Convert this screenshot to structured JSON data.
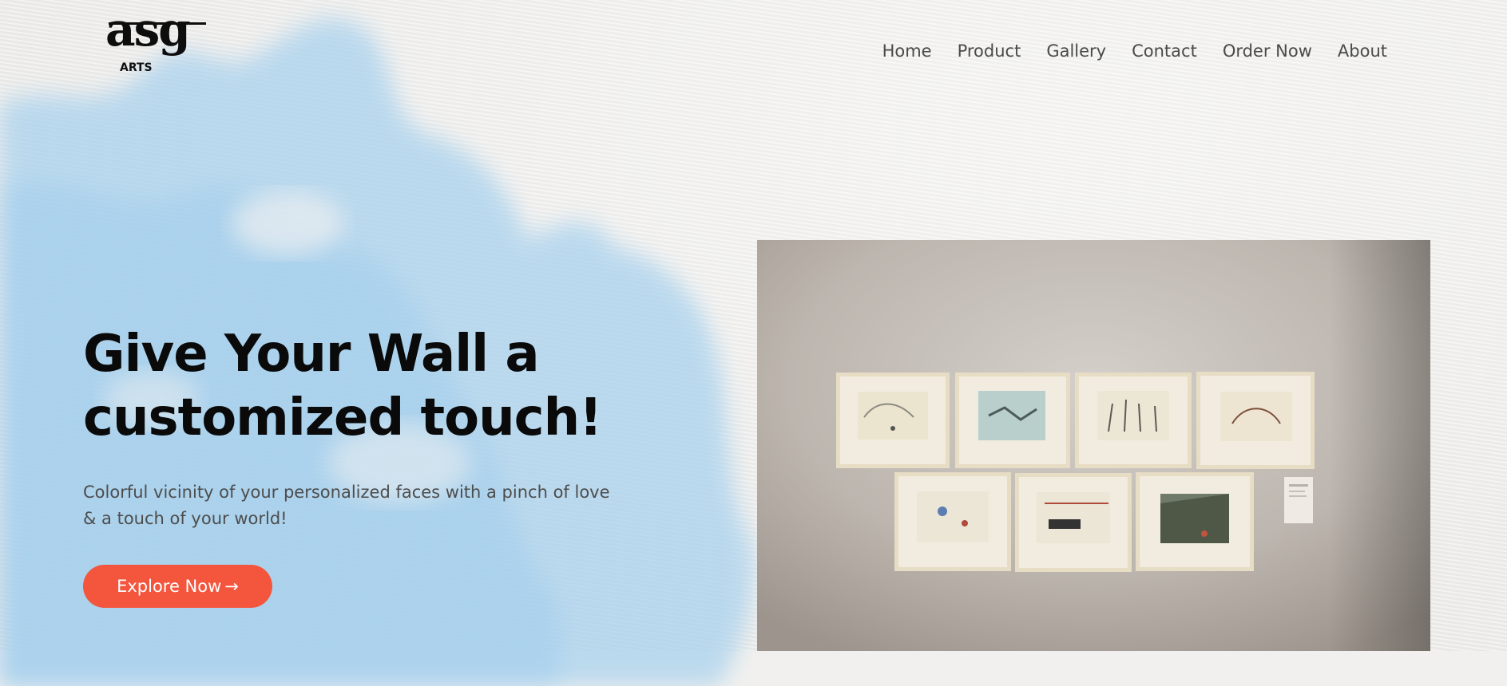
{
  "brand": {
    "logo_mark": "asg",
    "logo_sub": "ARTS"
  },
  "nav": {
    "items": [
      {
        "label": "Home"
      },
      {
        "label": "Product"
      },
      {
        "label": "Gallery"
      },
      {
        "label": "Contact"
      },
      {
        "label": "Order Now"
      },
      {
        "label": "About"
      }
    ]
  },
  "hero": {
    "title_line1": "Give Your Wall a",
    "title_line2": "customized touch!",
    "subtitle_line1": "Colorful vicinity of your personalized faces with a pinch of love",
    "subtitle_line2": "& a touch of your world!",
    "cta_label": "Explore Now",
    "cta_arrow": "→"
  },
  "colors": {
    "accent": "#f4553d",
    "text_dark": "#0a0a0a",
    "text_muted": "#4d4d4d",
    "wash_blue": "#a9d2ee"
  },
  "icons": {
    "cta_arrow": "arrow-right-icon"
  }
}
